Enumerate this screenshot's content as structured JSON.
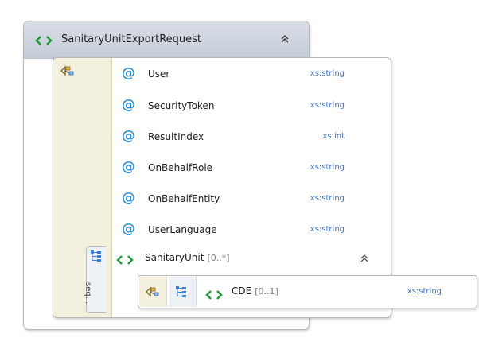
{
  "root": {
    "name": "SanitaryUnitExportRequest",
    "icon": "element-icon",
    "collapse_icon": "double-chevron-up-icon"
  },
  "sequence": {
    "icon": "model-group-icon",
    "attributes": [
      {
        "prefix": "@",
        "name": "User",
        "type": "xs:string"
      },
      {
        "prefix": "@",
        "name": "SecurityToken",
        "type": "xs:string"
      },
      {
        "prefix": "@",
        "name": "ResultIndex",
        "type": "xs:int"
      },
      {
        "prefix": "@",
        "name": "OnBehalfRole",
        "type": "xs:string"
      },
      {
        "prefix": "@",
        "name": "OnBehalfEntity",
        "type": "xs:string"
      },
      {
        "prefix": "@",
        "name": "UserLanguage",
        "type": "xs:string"
      }
    ]
  },
  "child": {
    "name": "SanitaryUnit",
    "cardinality": "[0..*]",
    "tab_label": "seq...",
    "icon": "element-icon",
    "collapse_icon": "double-chevron-up-icon",
    "element": {
      "name": "CDE",
      "cardinality": "[0..1]",
      "type": "xs:string",
      "icons": [
        "model-group-icon",
        "tree-icon",
        "element-icon"
      ]
    }
  },
  "colors": {
    "header_bg": "#cfd4de",
    "model_group_bg": "#f3f0dd",
    "attribute_at": "#2a8fd2",
    "type_text": "#3c74c4",
    "element_icon": "#1e9a38"
  }
}
